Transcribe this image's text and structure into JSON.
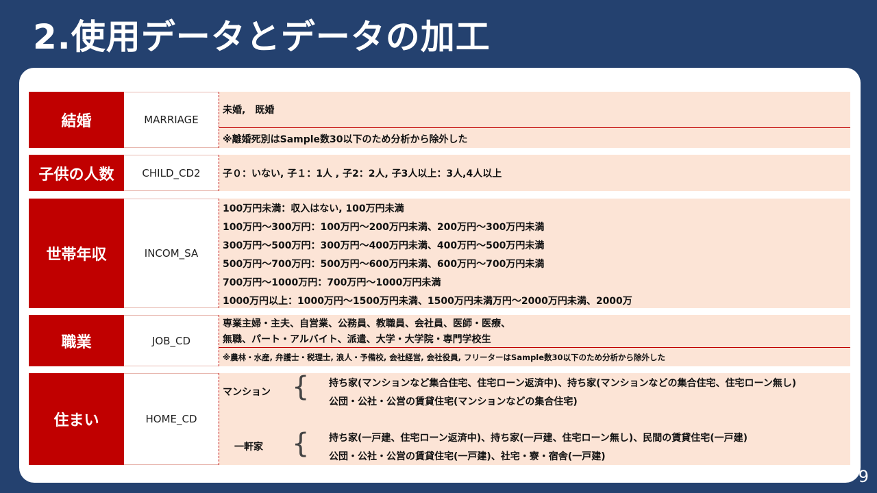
{
  "title": "2.使用データとデータの加工",
  "page_number": "9",
  "colors": {
    "background": "#24416f",
    "category": "#c00000",
    "desc_bg": "#fce4d6"
  },
  "rows": [
    {
      "category": "結婚",
      "code": "MARRIAGE",
      "lines": [
        "未婚,　既婚"
      ],
      "note": "※離婚死別はSample数30以下のため分析から除外した"
    },
    {
      "category": "子供の人数",
      "code": "CHILD_CD2",
      "lines": [
        "子０：いない, 子１：1人 , 子2：2人, 子3人以上：3人,4人以上"
      ]
    },
    {
      "category": "世帯年収",
      "code": "INCOM_SA",
      "lines": [
        "100万円未満：収入はない, 100万円未満",
        "100万円～300万円：100万円～200万円未満、200万円～300万円未満",
        "300万円～500万円：300万円～400万円未満、400万円～500万円未満",
        "500万円～700万円：500万円～600万円未満、600万円～700万円未満",
        "700万円～1000万円：700万円～1000万円未満",
        "1000万円以上：1000万円～1500万円未満、1500万円未満万円～2000万円未満、2000万"
      ]
    },
    {
      "category": "職業",
      "code": "JOB_CD",
      "lines": [
        "専業主婦・主夫、自営業、公務員、教職員、会社員、医師・医療、",
        "無職、パート・アルバイト、派遣、大学・大学院・専門学校生"
      ],
      "note": "※農林・水産, 弁護士・税理士, 浪人・予備校, 会社経営, 会社役員, フリーターはSample数30以下のため分析から除外した"
    },
    {
      "category": "住まい",
      "code": "HOME_CD",
      "groups": [
        {
          "label": "マンション",
          "items": [
            "持ち家(マンションなど集合住宅、住宅ローン返済中)、持ち家(マンションなどの集合住宅、住宅ローン無し)",
            "公団・公社・公営の賃貸住宅(マンションなどの集合住宅)"
          ]
        },
        {
          "label": "一軒家",
          "items": [
            "持ち家(一戸建、住宅ローン返済中)、持ち家(一戸建、住宅ローン無し)、民間の賃貸住宅(一戸建)",
            "公団・公社・公営の賃貸住宅(一戸建)、社宅・寮・宿舎(一戸建)"
          ]
        }
      ]
    }
  ]
}
